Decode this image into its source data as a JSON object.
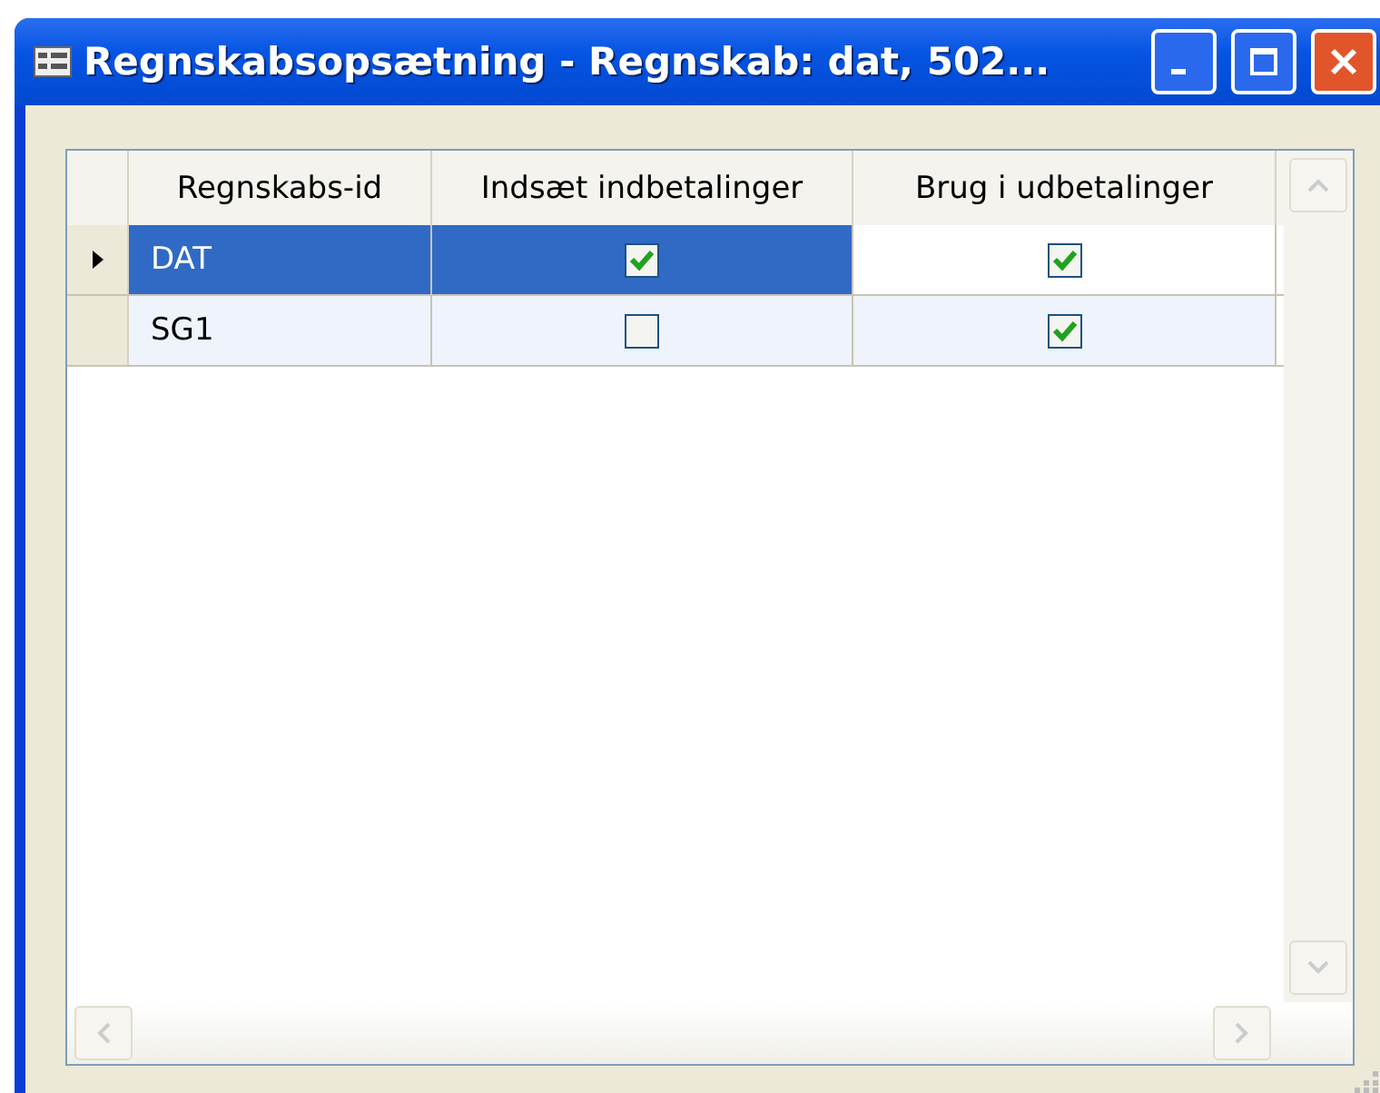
{
  "window": {
    "title": "Regnskabsopsætning - Regnskab: dat, 502..."
  },
  "table": {
    "columns": [
      "Regnskabs-id",
      "Indsæt indbetalinger",
      "Brug i udbetalinger"
    ],
    "rows": [
      {
        "selected": true,
        "cells": [
          {
            "kind": "text",
            "value": "DAT",
            "focused": false
          },
          {
            "kind": "check",
            "checked": true,
            "focused": false
          },
          {
            "kind": "check",
            "checked": true,
            "focused": true
          }
        ]
      },
      {
        "selected": false,
        "cells": [
          {
            "kind": "text",
            "value": "SG1",
            "focused": false
          },
          {
            "kind": "check",
            "checked": false,
            "focused": false
          },
          {
            "kind": "check",
            "checked": true,
            "focused": false
          }
        ]
      }
    ]
  }
}
